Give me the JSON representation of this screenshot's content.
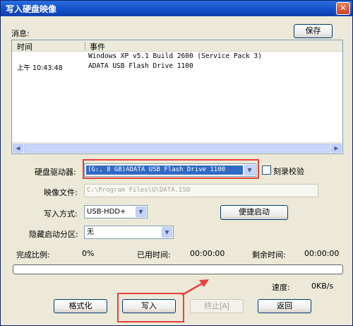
{
  "window": {
    "title": "写入硬盘映像",
    "close_glyph": "✕"
  },
  "messages": {
    "label": "消息:",
    "save_button": "保存",
    "columns": [
      "时间",
      "事件"
    ],
    "rows": [
      {
        "time": "",
        "event": "Windows XP v5.1 Build 2600 (Service Pack 3)"
      },
      {
        "time": "上午 10:43:48",
        "event": "ADATA    USB Flash Drive 1100"
      }
    ]
  },
  "form": {
    "drive_label": "硬盘驱动器:",
    "drive_value": "(G:, 8 GB)ADATA   USB Flash Drive 1100",
    "verify_label": "刻录校验",
    "image_file_label": "映像文件:",
    "image_file_value": "C:\\Program Files\\U\\DATA.ISO",
    "write_mode_label": "写入方式:",
    "write_mode_value": "USB-HDD+",
    "easy_boot_button": "便捷启动",
    "hidden_partition_label": "隐藏启动分区:",
    "hidden_partition_value": "无"
  },
  "status": {
    "complete_label": "完成比例:",
    "complete_value": "0%",
    "elapsed_label": "已用时间:",
    "elapsed_value": "00:00:00",
    "remaining_label": "剩余时间:",
    "remaining_value": "00:00:00",
    "speed_label": "速度:",
    "speed_value": "0KB/s",
    "progress_fraction": 0
  },
  "buttons": {
    "format": "格式化",
    "write": "写入",
    "stop": "终止[A]",
    "back": "返回"
  },
  "colors": {
    "highlight": "#e8413a",
    "title_bar": "#1450c8",
    "selection": "#316ac5"
  }
}
